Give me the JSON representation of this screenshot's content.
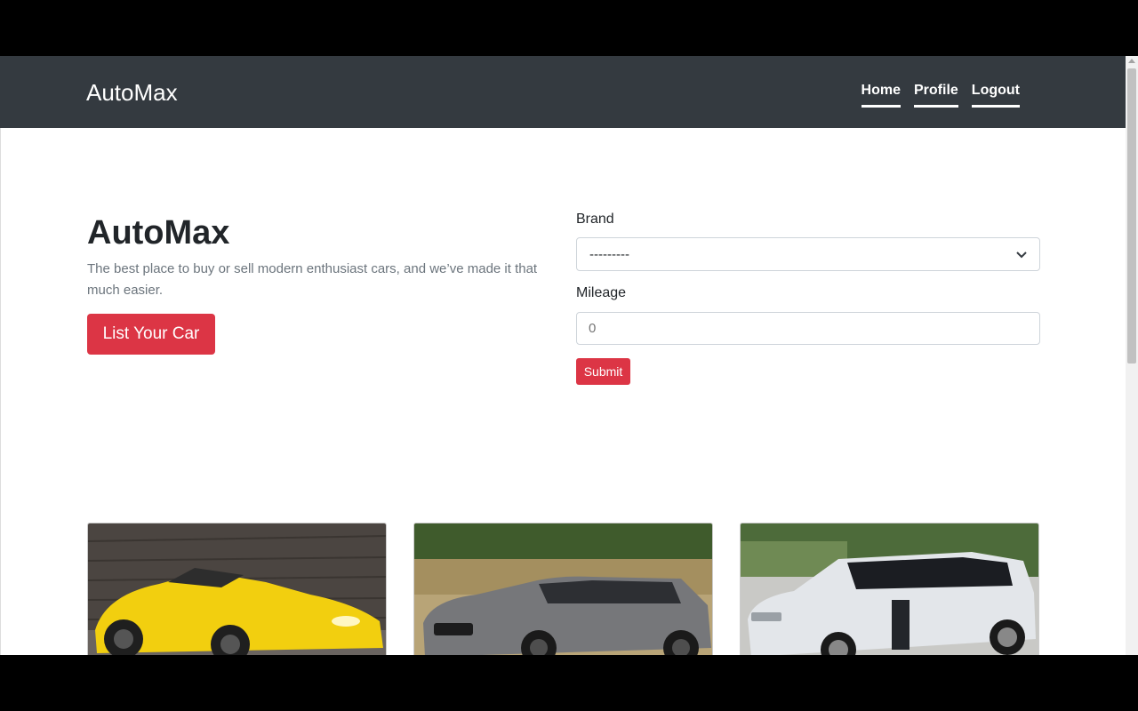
{
  "navbar": {
    "brand": "AutoMax",
    "links": [
      {
        "label": "Home"
      },
      {
        "label": "Profile"
      },
      {
        "label": "Logout"
      }
    ]
  },
  "hero": {
    "title": "AutoMax",
    "subtitle": "The best place to buy or sell modern enthusiast cars, and we’ve made it that much easier.",
    "cta_label": "List Your Car"
  },
  "filter_form": {
    "brand_label": "Brand",
    "brand_selected": "---------",
    "mileage_label": "Mileage",
    "mileage_value": "0",
    "submit_label": "Submit"
  },
  "listings": [
    {
      "image": "yellow-convertible-photo"
    },
    {
      "image": "grey-wagon-photo"
    },
    {
      "image": "white-suv-photo"
    }
  ],
  "colors": {
    "navbar_bg": "#343a40",
    "accent": "#dc3545"
  }
}
